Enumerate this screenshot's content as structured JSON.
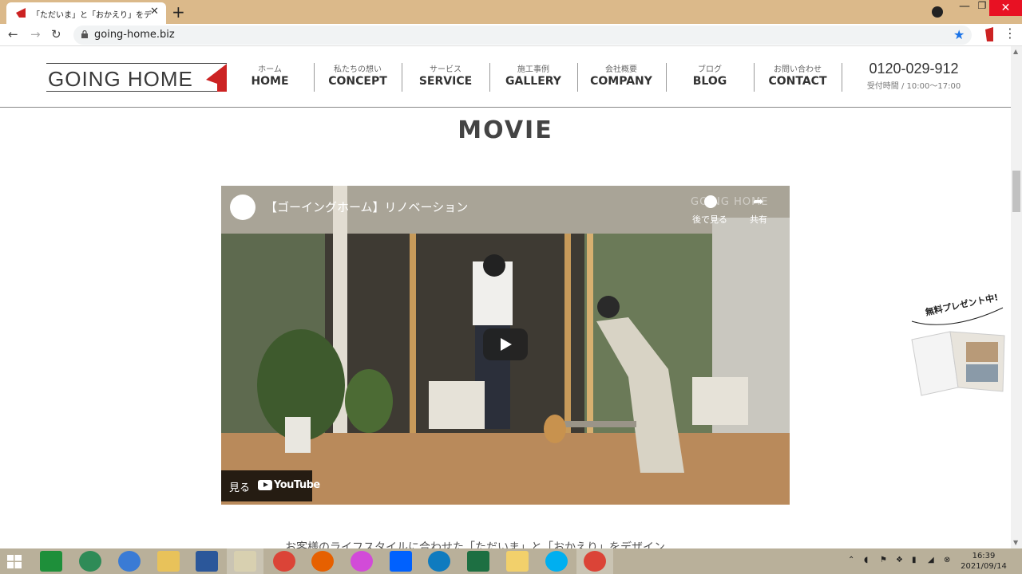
{
  "browser": {
    "tab_title": "「ただいま」と「おかえり」をデザインする",
    "url": "going-home.biz",
    "new_tab": "+",
    "close": "✕",
    "min": "—",
    "max": "❐",
    "win_close": "✕"
  },
  "header": {
    "logo": "GOING HOME",
    "nav": [
      {
        "jp": "ホーム",
        "en": "HOME"
      },
      {
        "jp": "私たちの想い",
        "en": "CONCEPT"
      },
      {
        "jp": "サービス",
        "en": "SERVICE"
      },
      {
        "jp": "施工事例",
        "en": "GALLERY"
      },
      {
        "jp": "会社概要",
        "en": "COMPANY"
      },
      {
        "jp": "ブログ",
        "en": "BLOG"
      },
      {
        "jp": "お問い合わせ",
        "en": "CONTACT"
      }
    ],
    "phone": "0120-029-912",
    "hours": "受付時間 / 10:00〜17:00"
  },
  "main": {
    "heading": "MOVIE",
    "video": {
      "title": "【ゴーイングホーム】リノベーション",
      "watch_later": "後で見る",
      "share": "共有",
      "watermark": "GOING HOME",
      "watch_on": "見る",
      "youtube": "YouTube"
    },
    "tagline": "お客様のライフスタイルに合わせた「ただいま」と「おかえり」をデザイン"
  },
  "present": {
    "label": "無料プレゼント中!"
  },
  "taskbar": {
    "time": "16:39",
    "date": "2021/09/14"
  },
  "colors": {
    "tabbar": "#dbb98a",
    "brand_red": "#cc2222",
    "taskbar": "#b9b09a"
  }
}
